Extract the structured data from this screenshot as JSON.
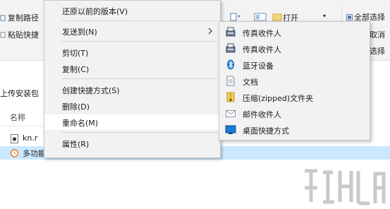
{
  "ribbon": {
    "copy_path": "复制路径",
    "paste_shortcut": "粘贴快捷",
    "open": "打开",
    "select_all": "全部选择",
    "select_none": "全部取消",
    "invert_selection": "反向选择"
  },
  "address": {
    "text": "上传安装包"
  },
  "file_list": {
    "column_name": "名称",
    "rows": [
      {
        "name": "kn.r"
      },
      {
        "name": "多功能闹钟.exe"
      }
    ]
  },
  "context_menu": {
    "items": [
      {
        "label": "还原以前的版本(V)"
      },
      {
        "label": "发送到(N)"
      },
      {
        "label": "剪切(T)"
      },
      {
        "label": "复制(C)"
      },
      {
        "label": "创建快捷方式(S)"
      },
      {
        "label": "删除(D)"
      },
      {
        "label": "重命名(M)"
      },
      {
        "label": "属性(R)"
      }
    ]
  },
  "send_to_menu": {
    "items": [
      {
        "label": "传真收件人",
        "icon": "fax-icon"
      },
      {
        "label": "传真收件人",
        "icon": "fax-icon"
      },
      {
        "label": "蓝牙设备",
        "icon": "bluetooth-icon"
      },
      {
        "label": "文档",
        "icon": "documents-icon"
      },
      {
        "label": "压缩(zipped)文件夹",
        "icon": "zip-folder-icon"
      },
      {
        "label": "邮件收件人",
        "icon": "mail-icon"
      },
      {
        "label": "桌面快捷方式",
        "icon": "desktop-icon"
      }
    ]
  },
  "colors": {
    "selection": "#cce8ff",
    "menu_background": "#f2f2f2",
    "accent": "#1979ca"
  }
}
